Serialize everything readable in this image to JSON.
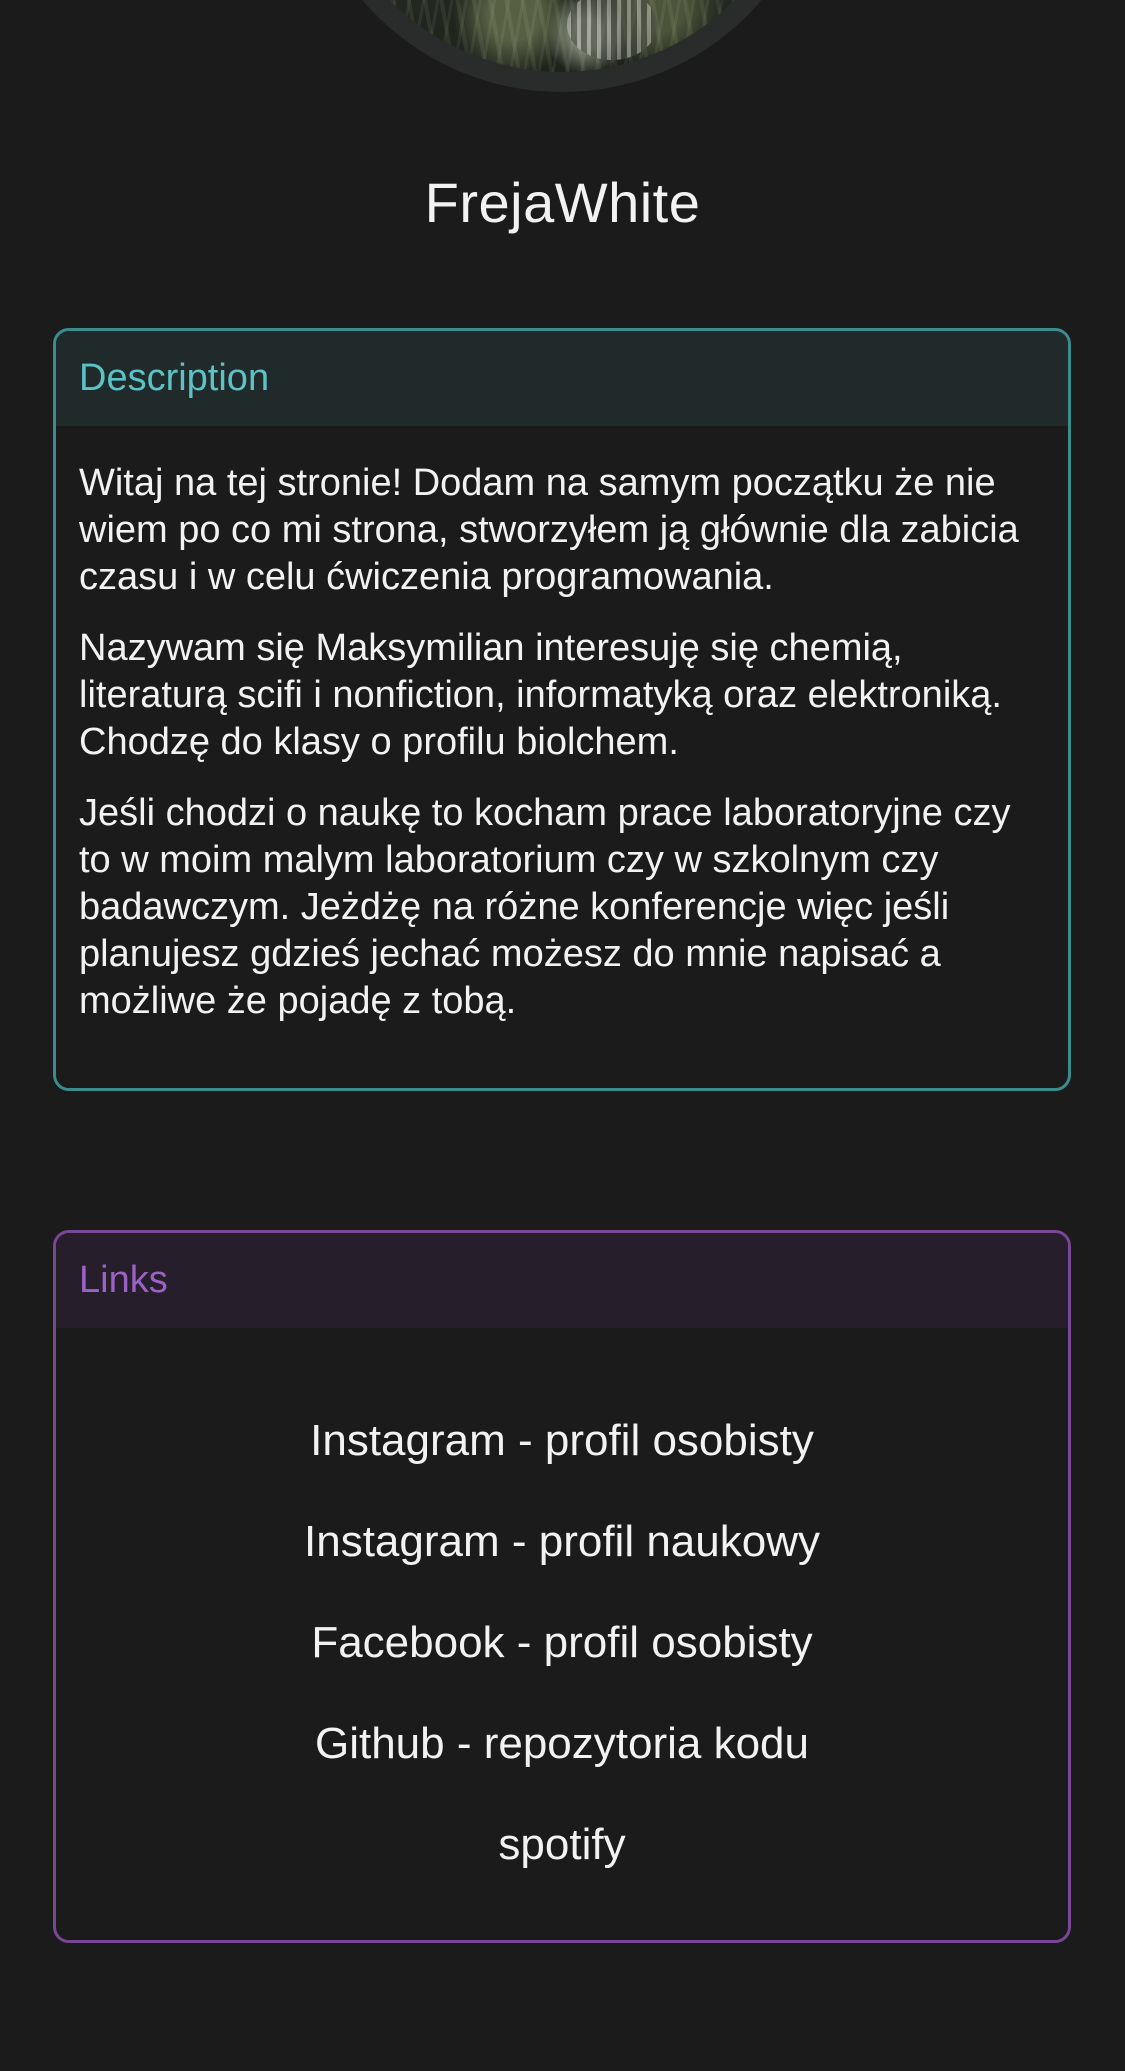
{
  "profile": {
    "username": "FrejaWhite",
    "avatar_icon": "profile-photo"
  },
  "description": {
    "header": "Description",
    "paragraphs": [
      "Witaj na tej stronie! Dodam na samym początku że nie wiem po co mi strona, stworzyłem ją głównie dla zabicia czasu i w celu ćwiczenia programowania.",
      "Nazywam się Maksymilian interesuję się chemią, literaturą scifi i nonfiction, informatyką oraz elektroniką. Chodzę do klasy o profilu biolchem.",
      "Jeśli chodzi o naukę to kocham prace laboratoryjne czy to w moim malym laboratorium czy w szkolnym czy badawczym. Jeżdżę na różne konferencje więc jeśli planujesz gdzieś jechać możesz do mnie napisać a możliwe że pojadę z tobą."
    ]
  },
  "links": {
    "header": "Links",
    "items": [
      "Instagram - profil osobisty",
      "Instagram - profil naukowy",
      "Facebook - profil osobisty",
      "Github - repozytoria kodu",
      "spotify"
    ]
  },
  "colors": {
    "background": "#1b1b1c",
    "description_accent": "#5bc3c6",
    "description_border": "#3b8d8d",
    "links_accent": "#9b62c6",
    "links_border": "#7a4696",
    "text": "#f2f2f2"
  }
}
